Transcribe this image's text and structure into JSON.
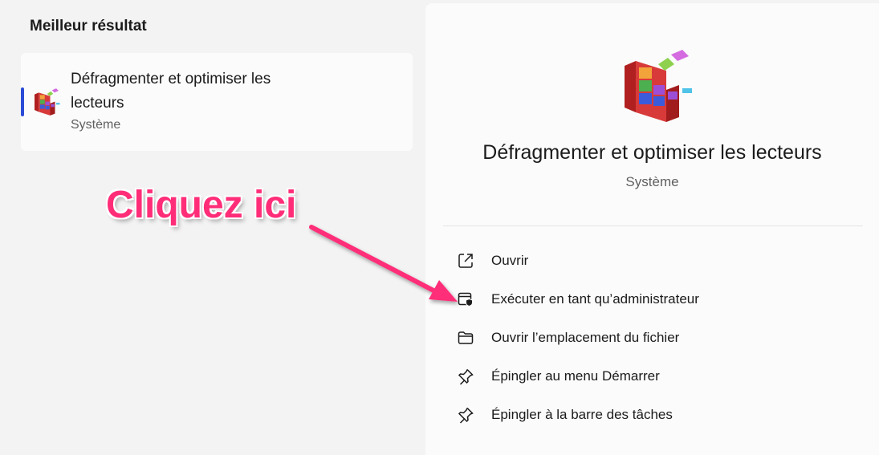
{
  "best_result": {
    "heading": "Meilleur résultat",
    "item": {
      "name": "Défragmenter et optimiser les lecteurs",
      "category": "Système"
    }
  },
  "detail": {
    "name": "Défragmenter et optimiser les lecteurs",
    "category": "Système",
    "actions": [
      {
        "label": "Ouvrir",
        "icon": "open-external-icon"
      },
      {
        "label": "Exécuter en tant qu’administrateur",
        "icon": "run-as-admin-shield-icon"
      },
      {
        "label": "Ouvrir l’emplacement du fichier",
        "icon": "folder-icon"
      },
      {
        "label": "Épingler au menu Démarrer",
        "icon": "pin-icon"
      },
      {
        "label": "Épingler à la barre des tâches",
        "icon": "pin-icon"
      }
    ]
  },
  "annotation": {
    "text": "Cliquez ici",
    "color": "#ff2d78"
  },
  "colors": {
    "accent": "#2b4bd6",
    "background": "#f3f3f3",
    "panel": "#fbfbfb"
  }
}
